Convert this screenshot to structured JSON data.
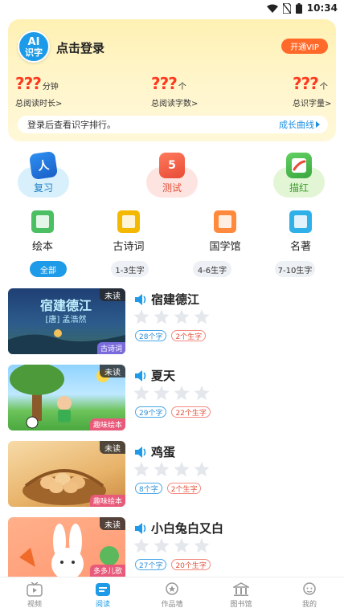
{
  "status_bar": {
    "time": "10:34"
  },
  "login_card": {
    "logo_line1": "AI",
    "logo_line2": "识字",
    "login_text": "点击登录",
    "vip_button": "开通VIP",
    "stats": [
      {
        "value": "???",
        "unit": "分钟",
        "label": "总阅读时长>"
      },
      {
        "value": "???",
        "unit": "个",
        "label": "总阅读字数>"
      },
      {
        "value": "???",
        "unit": "个",
        "label": "总识字量>"
      }
    ],
    "rank_text": "登录后查看识字排行。",
    "growth_link": "成长曲线"
  },
  "functions": [
    {
      "label": "复习",
      "icon": "person-book-icon"
    },
    {
      "label": "测试",
      "icon": "test-icon"
    },
    {
      "label": "描红",
      "icon": "pen-trace-icon"
    }
  ],
  "categories": [
    {
      "label": "绘本",
      "icon": "picture-book-icon"
    },
    {
      "label": "古诗词",
      "icon": "poetry-book-icon"
    },
    {
      "label": "国学馆",
      "icon": "scroll-wen-icon"
    },
    {
      "label": "名著",
      "icon": "open-book-icon"
    }
  ],
  "filters": [
    "全部",
    "1-3生字",
    "4-6生字",
    "7-10生字"
  ],
  "selected_filter": "全部",
  "books": [
    {
      "title": "宿建德江",
      "status": "未读",
      "tag": "古诗词",
      "tag_color": "#7a6bdc",
      "chars": "28个字",
      "new_chars": "2个生字",
      "art_title": "宿建德江",
      "art_sub": "[唐] 孟浩然",
      "stars": 0
    },
    {
      "title": "夏天",
      "status": "未读",
      "tag": "趣味绘本",
      "tag_color": "#e85a7a",
      "chars": "29个字",
      "new_chars": "22个生字",
      "stars": 0
    },
    {
      "title": "鸡蛋",
      "status": "未读",
      "tag": "趣味绘本",
      "tag_color": "#e85a7a",
      "chars": "8个字",
      "new_chars": "2个生字",
      "stars": 0
    },
    {
      "title": "小白兔白又白",
      "status": "未读",
      "tag": "多多儿歌",
      "tag_color": "#e85a7a",
      "chars": "27个字",
      "new_chars": "20个生字",
      "stars": 0
    }
  ],
  "bottom_nav": [
    {
      "label": "视频",
      "icon": "tv-icon"
    },
    {
      "label": "阅读",
      "icon": "reading-icon"
    },
    {
      "label": "作品墙",
      "icon": "medal-icon"
    },
    {
      "label": "图书馆",
      "icon": "library-icon"
    },
    {
      "label": "我的",
      "icon": "profile-icon"
    }
  ],
  "active_nav": "阅读",
  "colors": {
    "accent": "#1e9be8",
    "stat_red": "#ff3b1f",
    "vip_orange": "#ff6a2b"
  }
}
